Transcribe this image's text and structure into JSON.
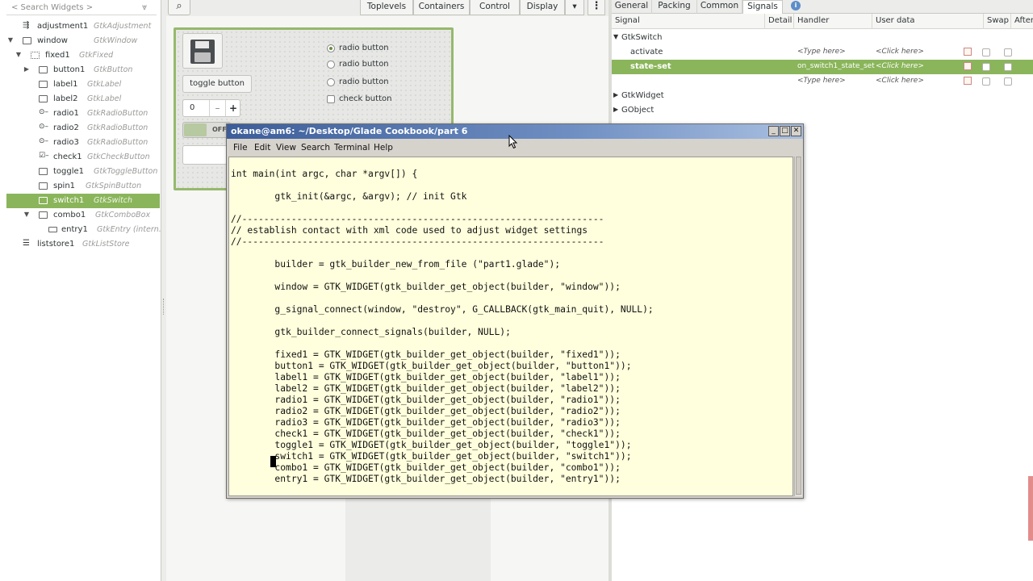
{
  "widget_tree": {
    "search_placeholder": "< Search Widgets >",
    "items": [
      {
        "name": "adjustment1",
        "type": "GtkAdjustment"
      },
      {
        "name": "window",
        "type": "GtkWindow"
      },
      {
        "name": "fixed1",
        "type": "GtkFixed"
      },
      {
        "name": "button1",
        "type": "GtkButton"
      },
      {
        "name": "label1",
        "type": "GtkLabel"
      },
      {
        "name": "label2",
        "type": "GtkLabel"
      },
      {
        "name": "radio1",
        "type": "GtkRadioButton"
      },
      {
        "name": "radio2",
        "type": "GtkRadioButton"
      },
      {
        "name": "radio3",
        "type": "GtkRadioButton"
      },
      {
        "name": "check1",
        "type": "GtkCheckButton"
      },
      {
        "name": "toggle1",
        "type": "GtkToggleButton"
      },
      {
        "name": "spin1",
        "type": "GtkSpinButton"
      },
      {
        "name": "switch1",
        "type": "GtkSwitch"
      },
      {
        "name": "combo1",
        "type": "GtkComboBox"
      },
      {
        "name": "entry1",
        "type": "GtkEntry (intern..."
      },
      {
        "name": "liststore1",
        "type": "GtkListStore"
      }
    ]
  },
  "toolbar": {
    "palette": [
      "Toplevels",
      "Containers",
      "Control",
      "Display"
    ],
    "kebab": "⋮",
    "dropdown": "▾"
  },
  "design": {
    "toggle_label": "toggle button",
    "spin_value": "0",
    "spin_minus": "–",
    "spin_plus": "+",
    "switch_state": "OFF",
    "radio_labels": [
      "radio button",
      "radio button",
      "radio button"
    ],
    "check_label": "check button"
  },
  "right_panel": {
    "tabs": [
      "General",
      "Packing",
      "Common",
      "Signals"
    ],
    "info": "i",
    "columns": [
      "Signal",
      "Detail",
      "Handler",
      "User data",
      "Swap",
      "After"
    ],
    "groups": {
      "gtkswitch": "GtkSwitch",
      "gtkwidget": "GtkWidget",
      "gobject": "GObject"
    },
    "rows": [
      {
        "signal": "activate",
        "handler": "<Type here>",
        "user_data": "<Click here>"
      },
      {
        "signal": "state-set",
        "handler": "on_switch1_state_set",
        "user_data": "<Click here>"
      },
      {
        "signal": "",
        "handler": "<Type here>",
        "user_data": "<Click here>"
      }
    ]
  },
  "terminal": {
    "title": "okane@am6: ~/Desktop/Glade Cookbook/part 6",
    "menu": [
      "File",
      "Edit",
      "View",
      "Search",
      "Terminal",
      "Help"
    ],
    "code": "int main(int argc, char *argv[]) {\n\n        gtk_init(&argc, &argv); // init Gtk\n\n//------------------------------------------------------------------\n// establish contact with xml code used to adjust widget settings\n//------------------------------------------------------------------\n\n        builder = gtk_builder_new_from_file (\"part1.glade\");\n\n        window = GTK_WIDGET(gtk_builder_get_object(builder, \"window\"));\n\n        g_signal_connect(window, \"destroy\", G_CALLBACK(gtk_main_quit), NULL);\n\n        gtk_builder_connect_signals(builder, NULL);\n\n        fixed1 = GTK_WIDGET(gtk_builder_get_object(builder, \"fixed1\"));\n        button1 = GTK_WIDGET(gtk_builder_get_object(builder, \"button1\"));\n        label1 = GTK_WIDGET(gtk_builder_get_object(builder, \"label1\"));\n        label2 = GTK_WIDGET(gtk_builder_get_object(builder, \"label2\"));\n        radio1 = GTK_WIDGET(gtk_builder_get_object(builder, \"radio1\"));\n        radio2 = GTK_WIDGET(gtk_builder_get_object(builder, \"radio2\"));\n        radio3 = GTK_WIDGET(gtk_builder_get_object(builder, \"radio3\"));\n        check1 = GTK_WIDGET(gtk_builder_get_object(builder, \"check1\"));\n        toggle1 = GTK_WIDGET(gtk_builder_get_object(builder, \"toggle1\"));\n        switch1 = GTK_WIDGET(gtk_builder_get_object(builder, \"switch1\"));\n        combo1 = GTK_WIDGET(gtk_builder_get_object(builder, \"combo1\"));\n        entry1 = GTK_WIDGET(gtk_builder_get_object(builder, \"entry1\"));"
  },
  "colors": {
    "selection_green": "#8ab55a",
    "terminal_bg": "#ffffdd",
    "titlebar_blue": "#3c5d99"
  }
}
